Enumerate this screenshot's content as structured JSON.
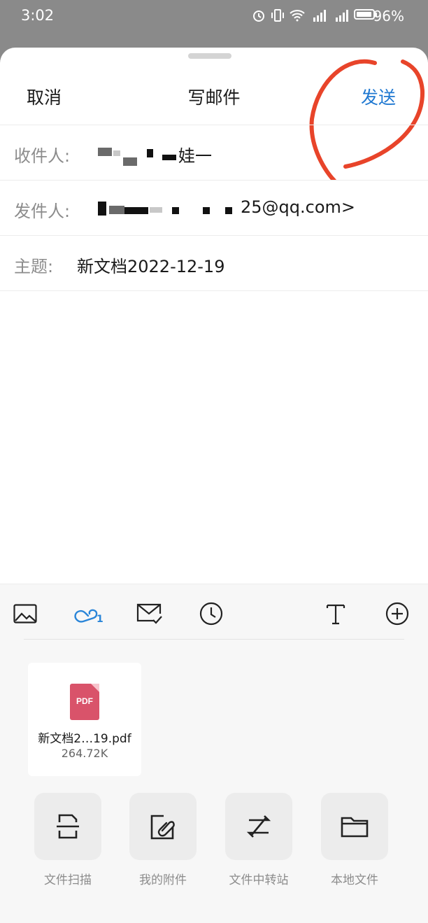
{
  "status": {
    "time": "3:02",
    "battery": "96%"
  },
  "header": {
    "cancel": "取消",
    "title": "写邮件",
    "send": "发送"
  },
  "fields": {
    "to_label": "收件人:",
    "to_value_tail": "娃一",
    "from_label": "发件人:",
    "from_value_tail": "25@qq.com>",
    "subject_label": "主题:",
    "subject_value": "新文档2022-12-19"
  },
  "toolbar": {
    "icons": [
      "image-icon",
      "attachment-icon",
      "mail-check-icon",
      "clock-icon",
      "text-icon",
      "plus-circle-icon"
    ],
    "attachment_count": "1"
  },
  "attachment": {
    "type": "PDF",
    "name": "新文档2…19.pdf",
    "size": "264.72K"
  },
  "actions": [
    {
      "label": "文件扫描",
      "icon": "scan-icon"
    },
    {
      "label": "我的附件",
      "icon": "my-attachment-icon"
    },
    {
      "label": "文件中转站",
      "icon": "transfer-icon"
    },
    {
      "label": "本地文件",
      "icon": "folder-icon"
    }
  ],
  "colors": {
    "accent": "#1f78d1",
    "annotation": "#e8442a",
    "pdf": "#d9536a"
  }
}
